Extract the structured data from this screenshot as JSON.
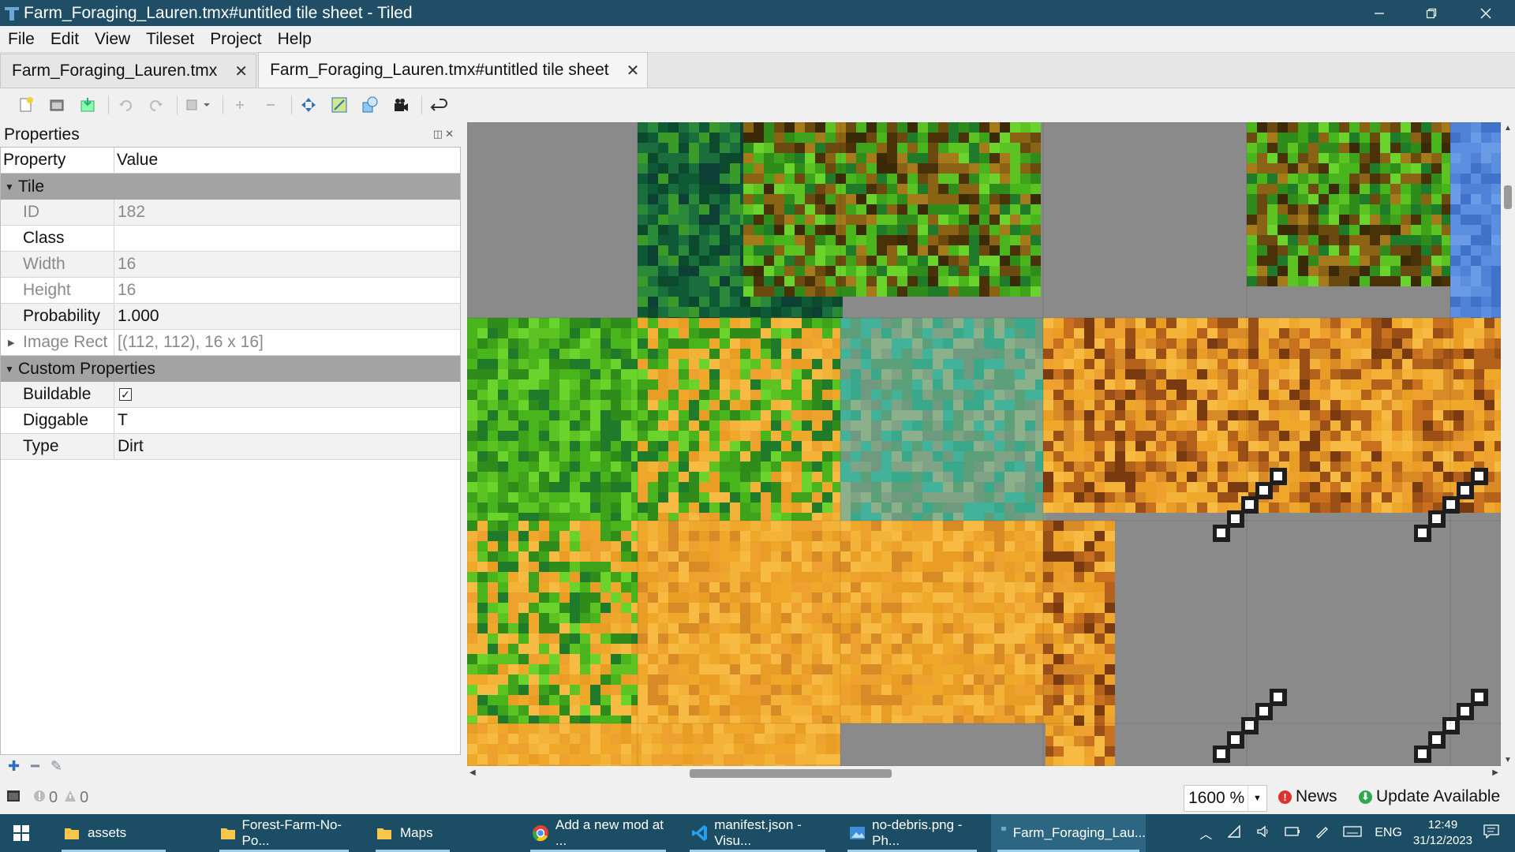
{
  "window": {
    "title": "Farm_Foraging_Lauren.tmx#untitled tile sheet - Tiled",
    "controls": [
      "minimize-icon",
      "restore-icon",
      "close-icon"
    ]
  },
  "menu": [
    "File",
    "Edit",
    "View",
    "Tileset",
    "Project",
    "Help"
  ],
  "tabs": [
    {
      "label": "Farm_Foraging_Lauren.tmx",
      "active": false
    },
    {
      "label": "Farm_Foraging_Lauren.tmx#untitled tile sheet",
      "active": true
    }
  ],
  "toolbar_icons": [
    "new-icon",
    "open-icon",
    "save-icon",
    "undo-icon",
    "redo-icon",
    "stamp-icon",
    "add-icon",
    "remove-icon",
    "move-icon",
    "tile-icon",
    "shapes-icon",
    "animation-icon",
    "back-icon"
  ],
  "properties": {
    "title": "Properties",
    "col_property": "Property",
    "col_value": "Value",
    "group_tile": "Tile",
    "group_custom": "Custom Properties",
    "tile_rows": [
      {
        "key": "ID",
        "value": "182",
        "readonly": true
      },
      {
        "key": "Class",
        "value": "",
        "readonly": false
      },
      {
        "key": "Width",
        "value": "16",
        "readonly": true
      },
      {
        "key": "Height",
        "value": "16",
        "readonly": true
      },
      {
        "key": "Probability",
        "value": "1.000",
        "readonly": false
      },
      {
        "key": "Image Rect",
        "value": "[(112, 112), 16 x 16]",
        "readonly": true
      }
    ],
    "custom_rows": [
      {
        "key": "Buildable",
        "value": "✓"
      },
      {
        "key": "Diggable",
        "value": "T"
      },
      {
        "key": "Type",
        "value": "Dirt"
      }
    ]
  },
  "status": {
    "errors": "0",
    "warnings": "0",
    "zoom": "1600 %",
    "news": "News",
    "update": "Update Available"
  },
  "taskbar": {
    "items": [
      {
        "label": "assets",
        "icon": "folder-icon"
      },
      {
        "label": "Forest-Farm-No-Po...",
        "icon": "folder-icon"
      },
      {
        "label": "Maps",
        "icon": "folder-icon"
      },
      {
        "label": "Add a new mod at ...",
        "icon": "chrome-icon"
      },
      {
        "label": "manifest.json - Visu...",
        "icon": "vscode-icon"
      },
      {
        "label": "no-debris.png - Ph...",
        "icon": "photos-icon"
      },
      {
        "label": "Farm_Foraging_Lau...",
        "icon": "tiled-icon"
      }
    ],
    "lang": "ENG",
    "time": "12:49",
    "date": "31/12/2023"
  },
  "colors": {
    "titlebar": "#1f4e66",
    "taskbar": "#1b4d65",
    "grass_dark": "#0f5a36",
    "grass_light": "#49b51c",
    "dirt": "#f0a82a",
    "dirt_dark": "#b4621b",
    "stone": "#8a8a8a",
    "water": "#4f82d6"
  }
}
